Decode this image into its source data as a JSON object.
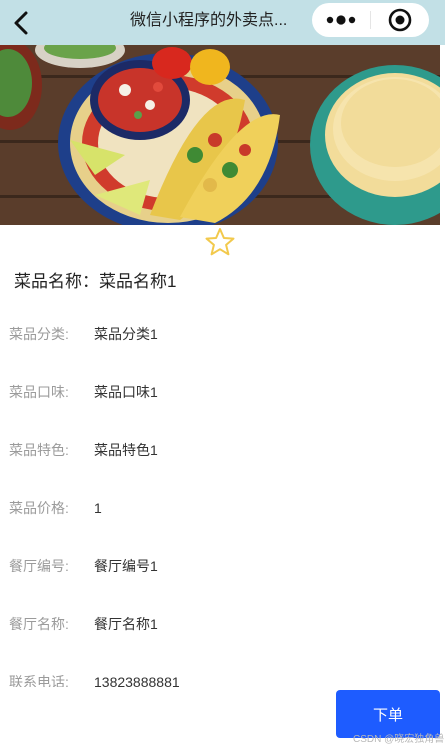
{
  "nav": {
    "title": "微信小程序的外卖点..."
  },
  "dish": {
    "name_label": "菜品名称：",
    "name_value": "菜品名称1"
  },
  "fields": [
    {
      "label": "菜品分类:",
      "value": "菜品分类1"
    },
    {
      "label": "菜品口味:",
      "value": "菜品口味1"
    },
    {
      "label": "菜品特色:",
      "value": "菜品特色1"
    },
    {
      "label": "菜品价格:",
      "value": "1"
    },
    {
      "label": "餐厅编号:",
      "value": "餐厅编号1"
    },
    {
      "label": "餐厅名称:",
      "value": "餐厅名称1"
    },
    {
      "label": "联系电话:",
      "value": "13823888881"
    }
  ],
  "actions": {
    "order_label": "下单"
  },
  "watermark": "CSDN @晓宏独角兽",
  "colors": {
    "topbar": "#c2e0e6",
    "accent": "#1e5cff",
    "star": "#f2c94c"
  },
  "icons": {
    "back": "chevron-left-icon",
    "more": "more-dots-icon",
    "close": "target-circle-icon",
    "favorite": "star-outline-icon"
  }
}
